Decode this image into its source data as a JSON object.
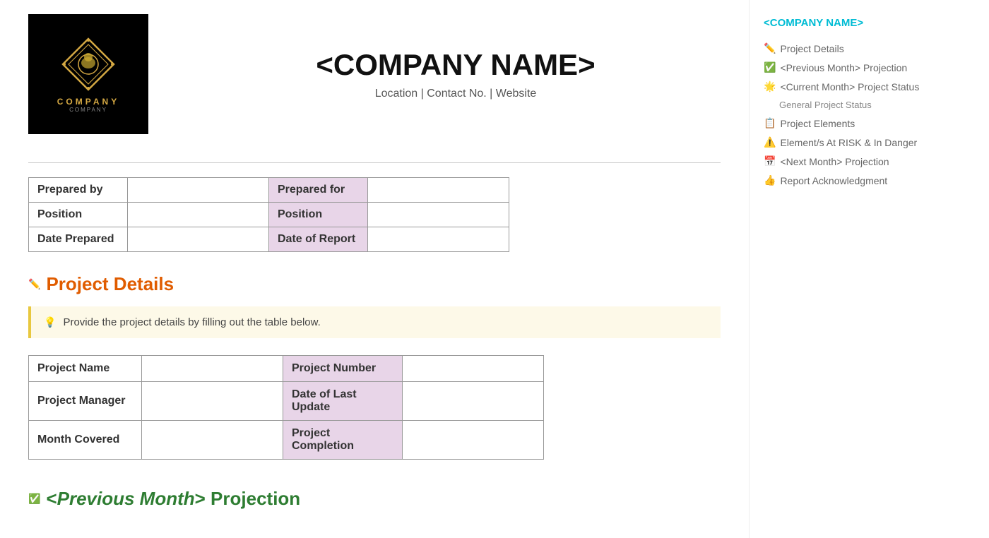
{
  "company": {
    "name": "<COMPANY NAME>",
    "contact": "Location | Contact No. | Website",
    "logo_text": "COMPANY",
    "logo_sub": "COMPANY"
  },
  "header_table": {
    "rows": [
      {
        "label1": "Prepared by",
        "value1": "",
        "label2": "Prepared for",
        "value2": ""
      },
      {
        "label1": "Position",
        "value1": "",
        "label2": "Position",
        "value2": ""
      },
      {
        "label1": "Date Prepared",
        "value1": "",
        "label2": "Date of Report",
        "value2": ""
      }
    ]
  },
  "project_details": {
    "title": "Project Details",
    "icon": "✏️",
    "hint": "Provide the project details by filling out the table below.",
    "hint_icon": "💡",
    "rows": [
      {
        "label1": "Project Name",
        "value1": "",
        "label2": "Project Number",
        "value2": ""
      },
      {
        "label1": "Project Manager",
        "value1": "",
        "label2": "Date of Last Update",
        "value2": ""
      },
      {
        "label1": "Month Covered",
        "value1": "",
        "label2": "Project Completion",
        "value2": ""
      }
    ]
  },
  "prev_month": {
    "icon": "✅",
    "prefix": "<",
    "italic": "Previous Month",
    "suffix": "> Projection"
  },
  "sidebar": {
    "company_name": "<COMPANY NAME>",
    "nav_items": [
      {
        "icon": "✏️",
        "label": "Project Details"
      },
      {
        "icon": "✅",
        "label": "<Previous Month> Projection"
      },
      {
        "icon": "🌟",
        "label": "<Current Month> Project Status"
      },
      {
        "icon": "",
        "label": "General Project Status",
        "sub": true
      },
      {
        "icon": "📋",
        "label": "Project Elements"
      },
      {
        "icon": "⚠️",
        "label": "Element/s At RISK & In Danger"
      },
      {
        "icon": "📅",
        "label": "<Next Month> Projection"
      },
      {
        "icon": "👍",
        "label": "Report Acknowledgment"
      }
    ]
  }
}
